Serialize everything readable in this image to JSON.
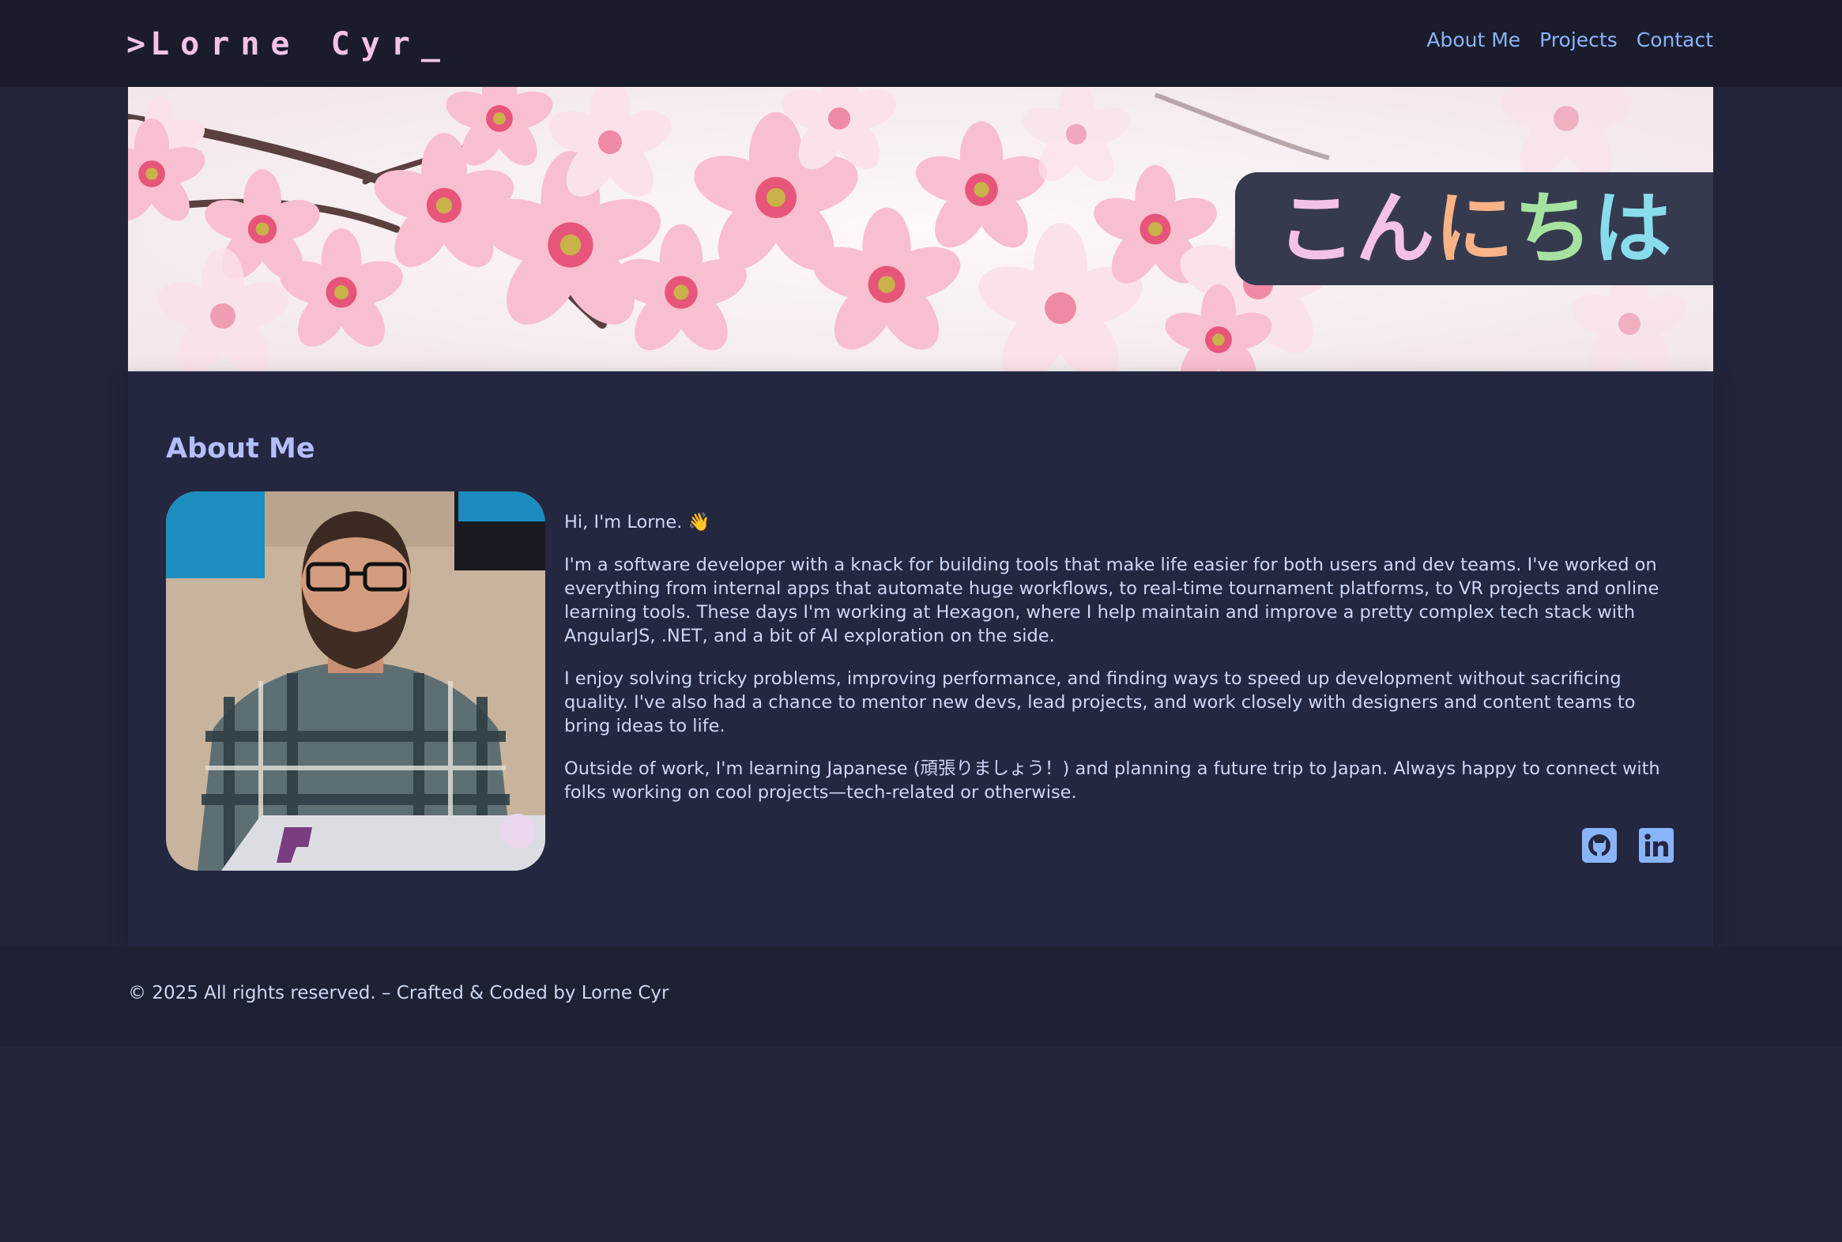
{
  "header": {
    "brand_prefix": ">",
    "brand_name": "Lorne Cyr",
    "brand_cursor": "_",
    "nav": [
      "About Me",
      "Projects",
      "Contact"
    ]
  },
  "banner": {
    "greeting_chars": [
      "こ",
      "ん",
      "に",
      "ち",
      "は"
    ],
    "greeting_colors": [
      "#f5c2e7",
      "#f5c2e7",
      "#fab387",
      "#a6e3a1",
      "#89dceb"
    ]
  },
  "about": {
    "title": "About Me",
    "greeting": "Hi, I'm Lorne. 👋",
    "paragraphs": [
      "I'm a software developer with a knack for building tools that make life easier for both users and dev teams. I've worked on everything from internal apps that automate huge workflows, to real-time tournament platforms, to VR projects and online learning tools. These days I'm working at Hexagon, where I help maintain and improve a pretty complex tech stack with AngularJS, .NET, and a bit of AI exploration on the side.",
      "I enjoy solving tricky problems, improving performance, and finding ways to speed up development without sacrificing quality. I've also had a chance to mentor new devs, lead projects, and work closely with designers and content teams to bring ideas to life.",
      "Outside of work, I'm learning Japanese (頑張りましょう！) and planning a future trip to Japan. Always happy to connect with folks working on cool projects—tech-related or otherwise."
    ],
    "social_icons": [
      "github-icon",
      "linkedin-icon"
    ]
  },
  "footer": {
    "text": "© 2025 All rights reserved. – Crafted & Coded by Lorne Cyr"
  },
  "colors": {
    "background": "#222539",
    "header_bg": "#1a1c2b",
    "accent_pink": "#f5c2e7",
    "link_blue": "#89b4fa",
    "title_lavender": "#b4befe",
    "text": "#cdd6f4"
  }
}
